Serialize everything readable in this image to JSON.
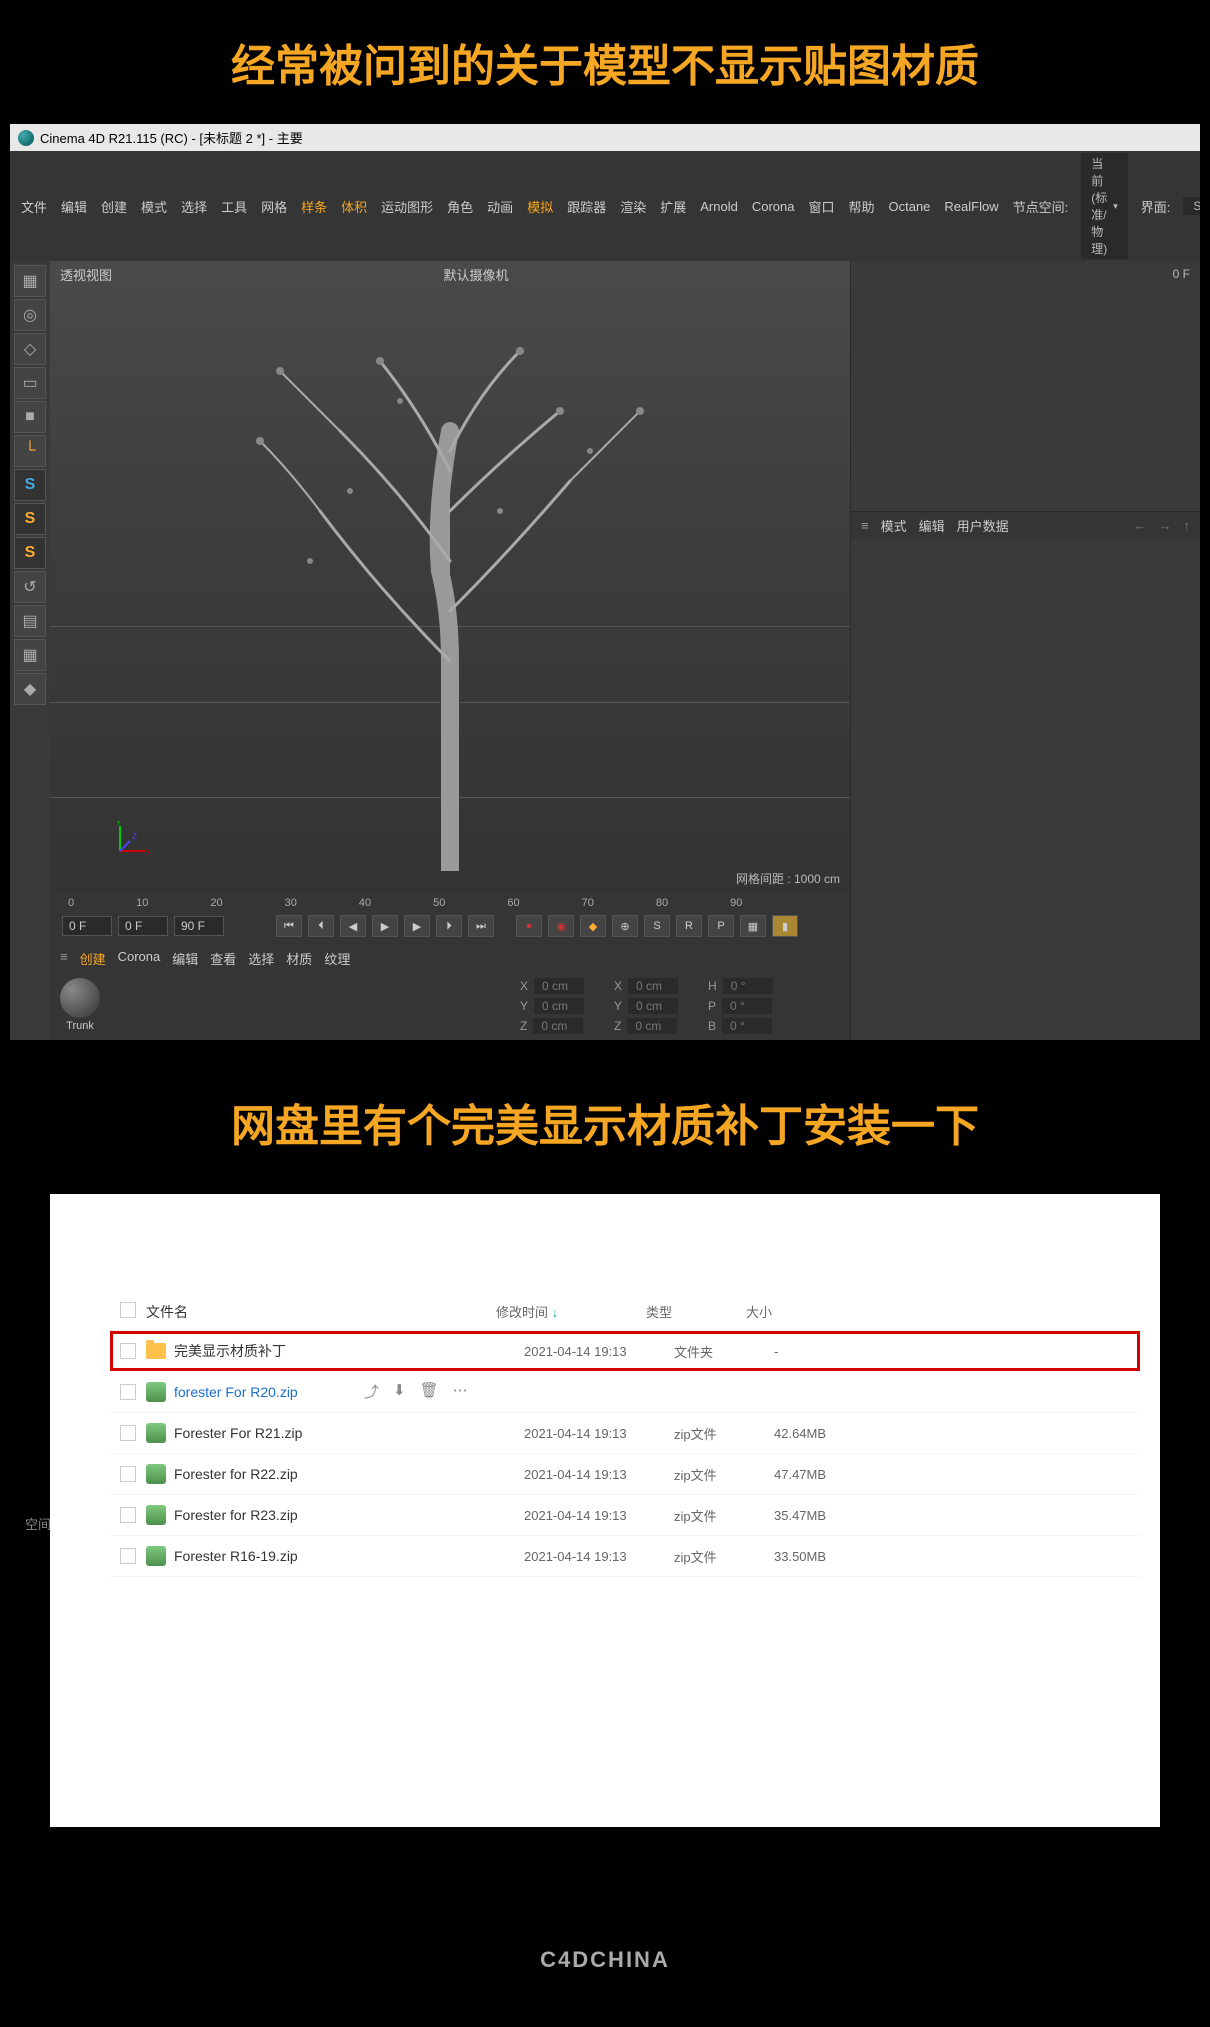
{
  "caption1": "经常被问到的关于模型不显示贴图材质",
  "caption2": "网盘里有个完美显示材质补丁安装一下",
  "watermark": "C4DCHINA",
  "c4d": {
    "title": "Cinema 4D R21.115 (RC) - [未标题 2 *] - 主要",
    "menu": [
      "文件",
      "编辑",
      "创建",
      "模式",
      "选择",
      "工具",
      "网格",
      "样条",
      "体积",
      "运动图形",
      "角色",
      "动画",
      "模拟",
      "跟踪器",
      "渲染",
      "扩展",
      "Arnold",
      "Corona",
      "窗口",
      "帮助",
      "Octane",
      "RealFlow"
    ],
    "menu_hot_indices": [
      7,
      8,
      12
    ],
    "space_label": "节点空间:",
    "space_dropdown": "当前 (标准/物理)",
    "interface_label": "界面:",
    "interface_dropdown": "Standard",
    "viewport": {
      "label": "透视视图",
      "camera": "默认摄像机",
      "grid": "网格间距 : 1000 cm"
    },
    "timeline": {
      "ticks": [
        "0",
        "10",
        "20",
        "30",
        "40",
        "50",
        "60",
        "70",
        "80",
        "90"
      ],
      "start": "0 F",
      "cur": "0 F",
      "end": "90 F",
      "zero_f": "0 F"
    },
    "matbar": [
      "创建",
      "Corona",
      "编辑",
      "查看",
      "选择",
      "材质",
      "纹理"
    ],
    "material_name": "Trunk",
    "coords": {
      "cols": [
        {
          "rows": [
            {
              "l": "X",
              "v": "0 cm"
            },
            {
              "l": "Y",
              "v": "0 cm"
            },
            {
              "l": "Z",
              "v": "0 cm"
            }
          ]
        },
        {
          "rows": [
            {
              "l": "X",
              "v": "0 cm"
            },
            {
              "l": "Y",
              "v": "0 cm"
            },
            {
              "l": "Z",
              "v": "0 cm"
            }
          ]
        },
        {
          "rows": [
            {
              "l": "H",
              "v": "0 °"
            },
            {
              "l": "P",
              "v": "0 °"
            },
            {
              "l": "B",
              "v": "0 °"
            }
          ]
        }
      ]
    },
    "right_tabs": [
      "模式",
      "编辑",
      "用户数据"
    ]
  },
  "browser": {
    "side_hint": "空间",
    "headers": {
      "name": "文件名",
      "mtime": "修改时间",
      "type": "类型",
      "size": "大小"
    },
    "files": [
      {
        "name": "完美显示材质补丁",
        "mtime": "2021-04-14 19:13",
        "type": "文件夹",
        "size": "-",
        "icon": "folder",
        "hl": true
      },
      {
        "name": "forester For R20.zip",
        "mtime": "",
        "type": "",
        "size": "",
        "icon": "zip",
        "blue": true,
        "actions": true
      },
      {
        "name": "Forester For R21.zip",
        "mtime": "2021-04-14 19:13",
        "type": "zip文件",
        "size": "42.64MB",
        "icon": "zip"
      },
      {
        "name": "Forester for R22.zip",
        "mtime": "2021-04-14 19:13",
        "type": "zip文件",
        "size": "47.47MB",
        "icon": "zip"
      },
      {
        "name": "Forester for R23.zip",
        "mtime": "2021-04-14 19:13",
        "type": "zip文件",
        "size": "35.47MB",
        "icon": "zip"
      },
      {
        "name": "Forester R16-19.zip",
        "mtime": "2021-04-14 19:13",
        "type": "zip文件",
        "size": "33.50MB",
        "icon": "zip"
      }
    ]
  },
  "tool_icons": [
    "▦",
    "◎",
    "◇",
    "▭",
    "■",
    "└",
    "S",
    "S",
    "S",
    "↺",
    "▤",
    "▦",
    "◆"
  ]
}
